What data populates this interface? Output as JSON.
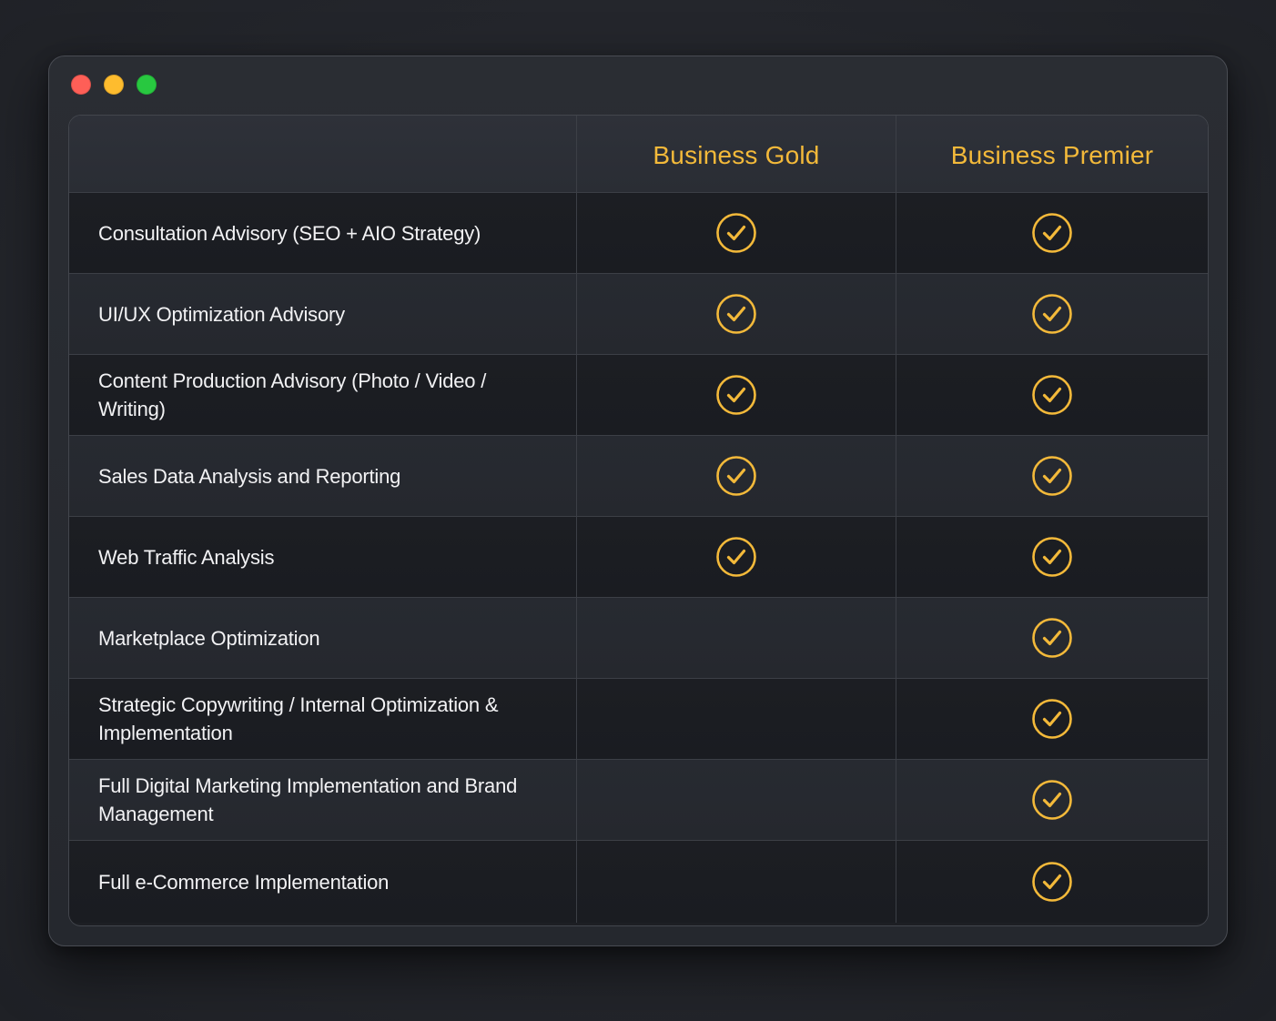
{
  "window": {
    "controls": [
      "close",
      "minimize",
      "zoom"
    ]
  },
  "table": {
    "columns": [
      {
        "label": ""
      },
      {
        "label": "Business Gold"
      },
      {
        "label": "Business Premier"
      }
    ],
    "rows": [
      {
        "feature": "Consultation Advisory (SEO + AIO Strategy)",
        "gold": true,
        "premier": true
      },
      {
        "feature": "UI/UX Optimization Advisory",
        "gold": true,
        "premier": true
      },
      {
        "feature": "Content Production Advisory (Photo / Video / Writing)",
        "gold": true,
        "premier": true
      },
      {
        "feature": "Sales Data Analysis and Reporting",
        "gold": true,
        "premier": true
      },
      {
        "feature": "Web Traffic Analysis",
        "gold": true,
        "premier": true
      },
      {
        "feature": "Marketplace Optimization",
        "gold": false,
        "premier": true
      },
      {
        "feature": "Strategic Copywriting / Internal Optimization & Implementation",
        "gold": false,
        "premier": true
      },
      {
        "feature": "Full Digital Marketing Implementation and Brand Management",
        "gold": false,
        "premier": true
      },
      {
        "feature": "Full e-Commerce Implementation",
        "gold": false,
        "premier": true
      }
    ]
  },
  "icons": {
    "included": "check-circle-icon"
  },
  "colors": {
    "accent": "#f3b93a",
    "background": "#24262c",
    "text": "#f2f2f4"
  }
}
